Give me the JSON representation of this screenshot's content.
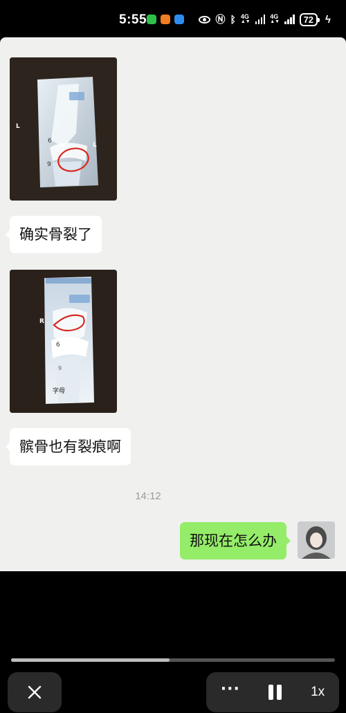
{
  "status_bar": {
    "time": "5:55",
    "network1": "4G",
    "network2": "4G",
    "battery": "72",
    "app_badges": [
      "wechat-icon",
      "camera-app-icon",
      "message-app-icon"
    ]
  },
  "chat": {
    "messages": [
      {
        "type": "image",
        "side": "left",
        "description_icon": "knee-xray-lateral-image",
        "labels": [
          "L",
          "6",
          "9",
          "L"
        ]
      },
      {
        "type": "text",
        "side": "left",
        "text": "确实骨裂了"
      },
      {
        "type": "image",
        "side": "left",
        "description_icon": "knee-xray-frontal-image",
        "labels": [
          "R",
          "6",
          "9",
          "字母"
        ]
      },
      {
        "type": "text",
        "side": "left",
        "text": "髌骨也有裂痕啊"
      },
      {
        "type": "text",
        "side": "right",
        "text": "那现在怎么办"
      }
    ],
    "timestamp": "14:12"
  },
  "player": {
    "progress": 0.49,
    "speed_label": "1x",
    "more_label": "···",
    "colors": {
      "progress_fill": "#bdbdbd",
      "progress_track": "#555555"
    }
  },
  "colors": {
    "self_bubble": "#95ec69",
    "other_bubble": "#ffffff",
    "chat_bg": "#f0f0ee"
  }
}
